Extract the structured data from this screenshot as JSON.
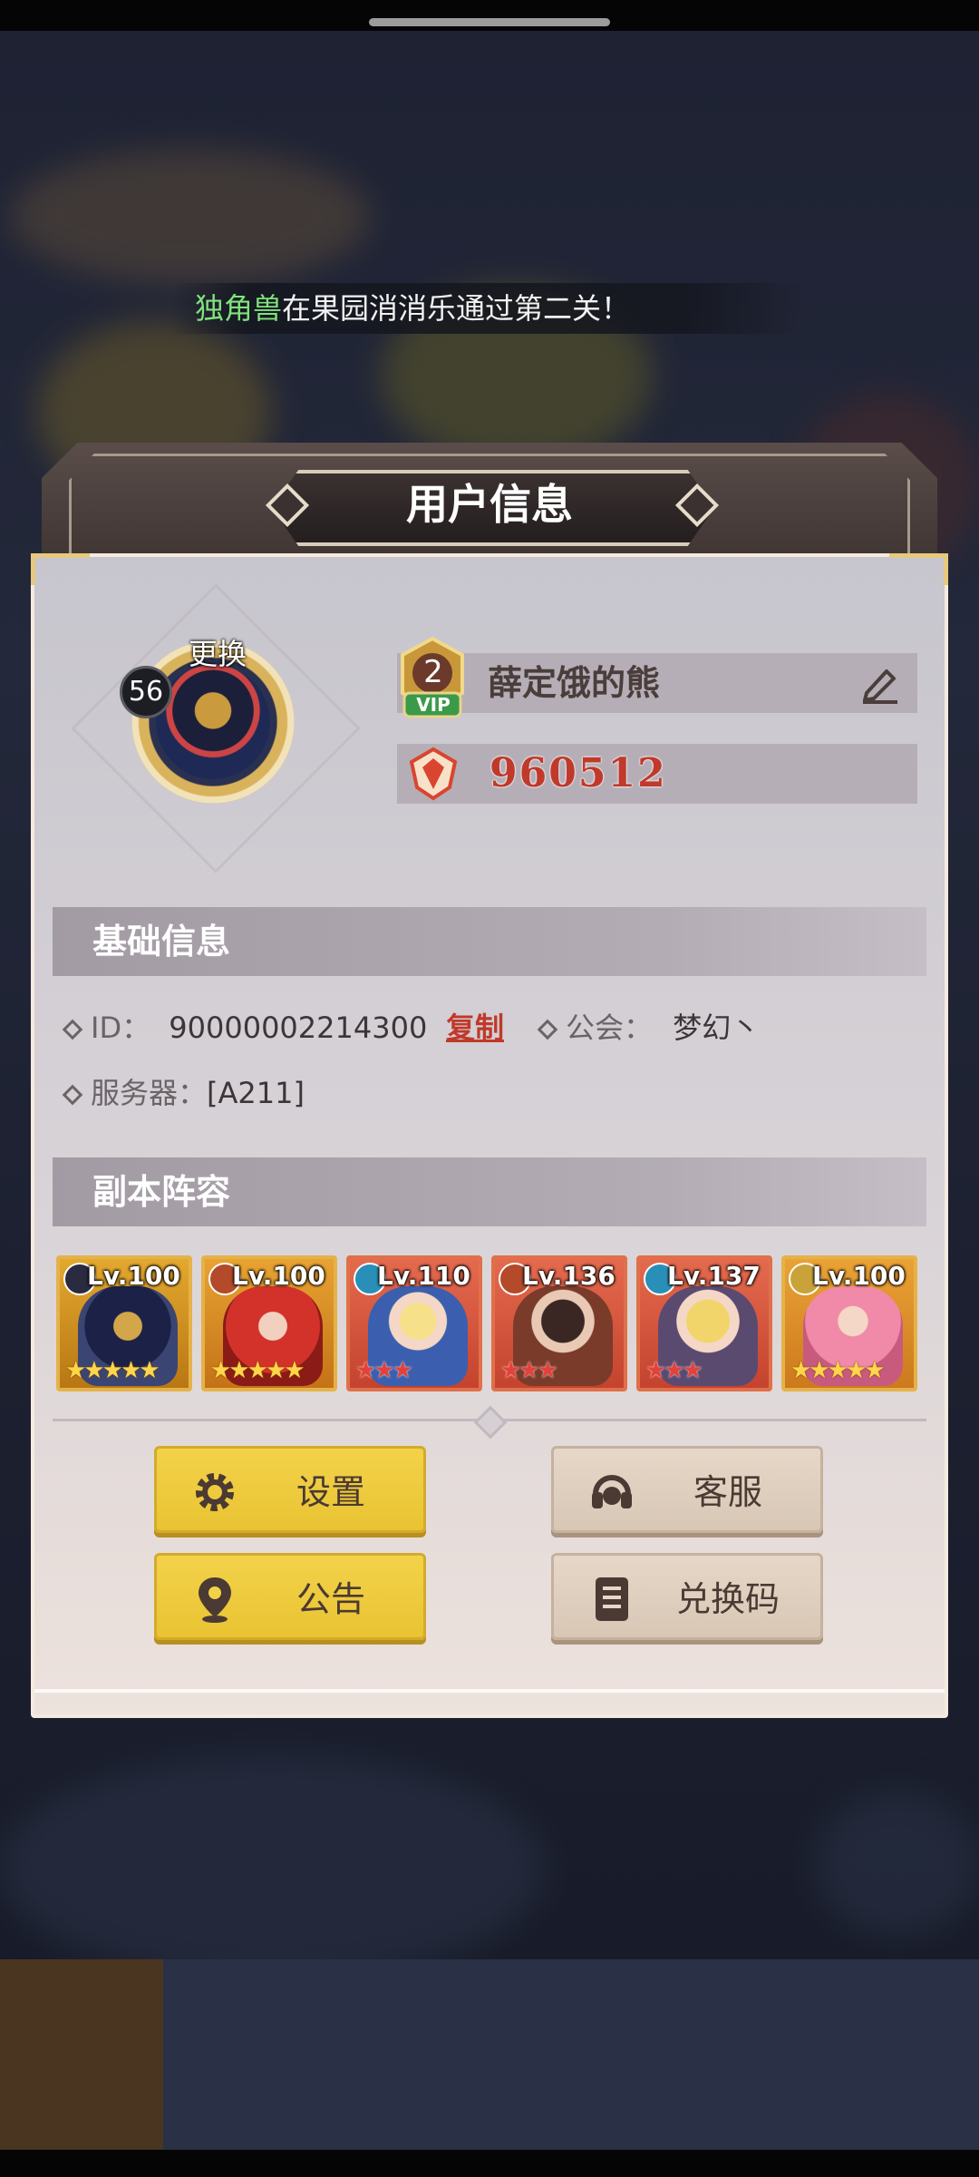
{
  "ticker": {
    "player": "独角兽",
    "message": "在果园消消乐通过第二关！"
  },
  "dialog": {
    "title": "用户信息",
    "avatar": {
      "level": "56",
      "change_label": "更换"
    },
    "vip_level": "2",
    "vip_label": "VIP",
    "username": "薛定饿的熊",
    "power": "960512",
    "basic_info": {
      "heading": "基础信息",
      "id_label": "ID：",
      "id_value": "90000002214300",
      "copy_label": "复制",
      "guild_label": "公会：",
      "guild_value": "梦幻丶",
      "server_label": "服务器：",
      "server_value": "[A211]"
    },
    "lineup": {
      "heading": "副本阵容",
      "heroes": [
        {
          "level": "Lv.100",
          "stars": "★★★★★",
          "star_color": "gold",
          "frame": "gold"
        },
        {
          "level": "Lv.100",
          "stars": "★★★★★",
          "star_color": "gold",
          "frame": "gold"
        },
        {
          "level": "Lv.110",
          "stars": "★★★",
          "star_color": "red",
          "frame": "red"
        },
        {
          "level": "Lv.136",
          "stars": "★★★",
          "star_color": "red",
          "frame": "red"
        },
        {
          "level": "Lv.137",
          "stars": "★★★",
          "star_color": "red",
          "frame": "red"
        },
        {
          "level": "Lv.100",
          "stars": "★★★★★",
          "star_color": "gold",
          "frame": "gold"
        }
      ]
    },
    "buttons": {
      "settings": "设置",
      "support": "客服",
      "announcement": "公告",
      "redeem_code": "兑换码"
    }
  },
  "colors": {
    "accent_yellow": "#f3d24a",
    "beige": "#e6d7c8",
    "power_red": "#c0392b",
    "ticker_name_green": "#7fe37a"
  }
}
